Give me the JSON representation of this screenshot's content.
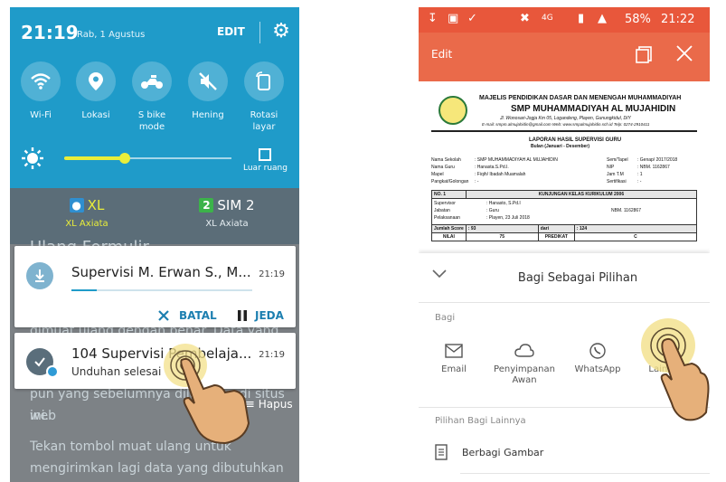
{
  "left": {
    "quick_settings": {
      "time": "21:19",
      "date": "Rab, 1 Agustus",
      "edit_label": "EDIT",
      "toggles": [
        {
          "label": "Wi-Fi",
          "icon": "wifi-icon"
        },
        {
          "label": "Lokasi",
          "icon": "location-pin-icon"
        },
        {
          "label": "S bike mode",
          "icon": "motorbike-icon"
        },
        {
          "label": "Hening",
          "icon": "mute-icon"
        },
        {
          "label": "Rotasi layar",
          "icon": "rotate-screen-icon"
        }
      ],
      "brightness_level": 0.36,
      "outdoor_label": "Luar ruang"
    },
    "sims": [
      {
        "badge": "",
        "name": "XL",
        "carrier": "XL Axiata"
      },
      {
        "badge": "2",
        "name": "SIM 2",
        "carrier": "XL Axiata"
      }
    ],
    "background_text": {
      "line1": "Ulang Formulir",
      "line2": "dimuat ulang dengan benar. Data yang",
      "line3": "pun yang sebelumnya dilakukan di situs web",
      "line4": "ini.",
      "line5": "Tekan tombol muat ulang untuk",
      "line6": "mengirimkan lagi data yang dibutuhkan"
    },
    "download_notification": {
      "title": "Supervisi M. Erwan S., M...",
      "time": "21:19",
      "progress": 0.14,
      "cancel_label": "BATAL",
      "pause_label": "JEDA"
    },
    "completed_notification": {
      "title": "104 Supervisi Pembelaja...",
      "subtitle": "Unduhan selesai",
      "time": "21:19"
    },
    "clear_label": "Hapus"
  },
  "right": {
    "status": {
      "battery": "58%",
      "time": "21:22",
      "network": "4G"
    },
    "toolbar": {
      "edit_label": "Edit"
    },
    "document": {
      "header1": "MAJELIS PENDIDIKAN DASAR DAN MENENGAH MUHAMMADIYAH",
      "header2": "SMP MUHAMMADIYAH AL MUJAHIDIN",
      "address": "Jl. Wonosari-Jogja Km 05, Logandeng, Playen, Gunungkidul, DIY",
      "contact": "E-mail: smpm.almujahidin@gmail.com  Web: www.smpalmujahidin.sch.id  Telp: 0274-2910411",
      "title": "LAPORAN HASIL SUPERVISI GURU",
      "subtitle": "Bulan (Januari - Desember)",
      "fields": [
        {
          "k": "Nama Sekolah",
          "v": ": SMP MUHAMMADIYAH AL MUJAHIDIN",
          "k2": "Sem/Tapel",
          "v2": ": Genap/ 2017/2018"
        },
        {
          "k": "Nama Guru",
          "v": ": Hanasta.S.Pd.I.",
          "k2": "NIP",
          "v2": ": NBM. 1162867"
        },
        {
          "k": "Mapel",
          "v": ": Fiqih/ Ibadah Muamalah",
          "k2": "Jam T.M",
          "v2": ": 1"
        },
        {
          "k": "Pangkat/Golongan",
          "v": ": -",
          "k2": "Sertifikasi",
          "v2": ": -"
        }
      ],
      "table_no": "NO. 1",
      "table_head": "KUNJUNGAN KELAS KURIKULUM 2006",
      "supervisor": "Supervisor",
      "supervisor_val": ": Hanasto, S.Pd.I",
      "jabatan": "Jabatan",
      "jabatan_val": ": Guru",
      "jabatan_nbm": "NBM. 1162867",
      "pelaksanaan": "Pelaksanaan",
      "pelaksanaan_val": ": Playen, 23 Juli 2018",
      "jumlah": "Jumlah Score",
      "jumlah_val": ": 93",
      "dari": "dari",
      "dari_val": ": 124",
      "nilai": "NILAI",
      "nilai_val": "75",
      "predikat": "PREDIKAT",
      "predikat_val": "C"
    },
    "share_sheet": {
      "title": "Bagi Sebagai Pilihan",
      "section_label": "Bagi",
      "apps": [
        {
          "label": "Email",
          "icon": "mail-icon"
        },
        {
          "label": "Penyimpanan Awan",
          "icon": "cloud-icon"
        },
        {
          "label": "WhatsApp",
          "icon": "whatsapp-icon"
        },
        {
          "label": "Lainnya",
          "icon": "more-icon"
        }
      ],
      "more_label": "Pilihan Bagi Lainnya",
      "share_image_label": "Berbagi Gambar"
    }
  },
  "colors": {
    "qs_blue": "#1f9bc9",
    "accent_yellow": "#e9ee3a",
    "samsung_orange": "#ea6a4a",
    "status_orange": "#e8573b",
    "tap_highlight": "#f3e08a"
  }
}
